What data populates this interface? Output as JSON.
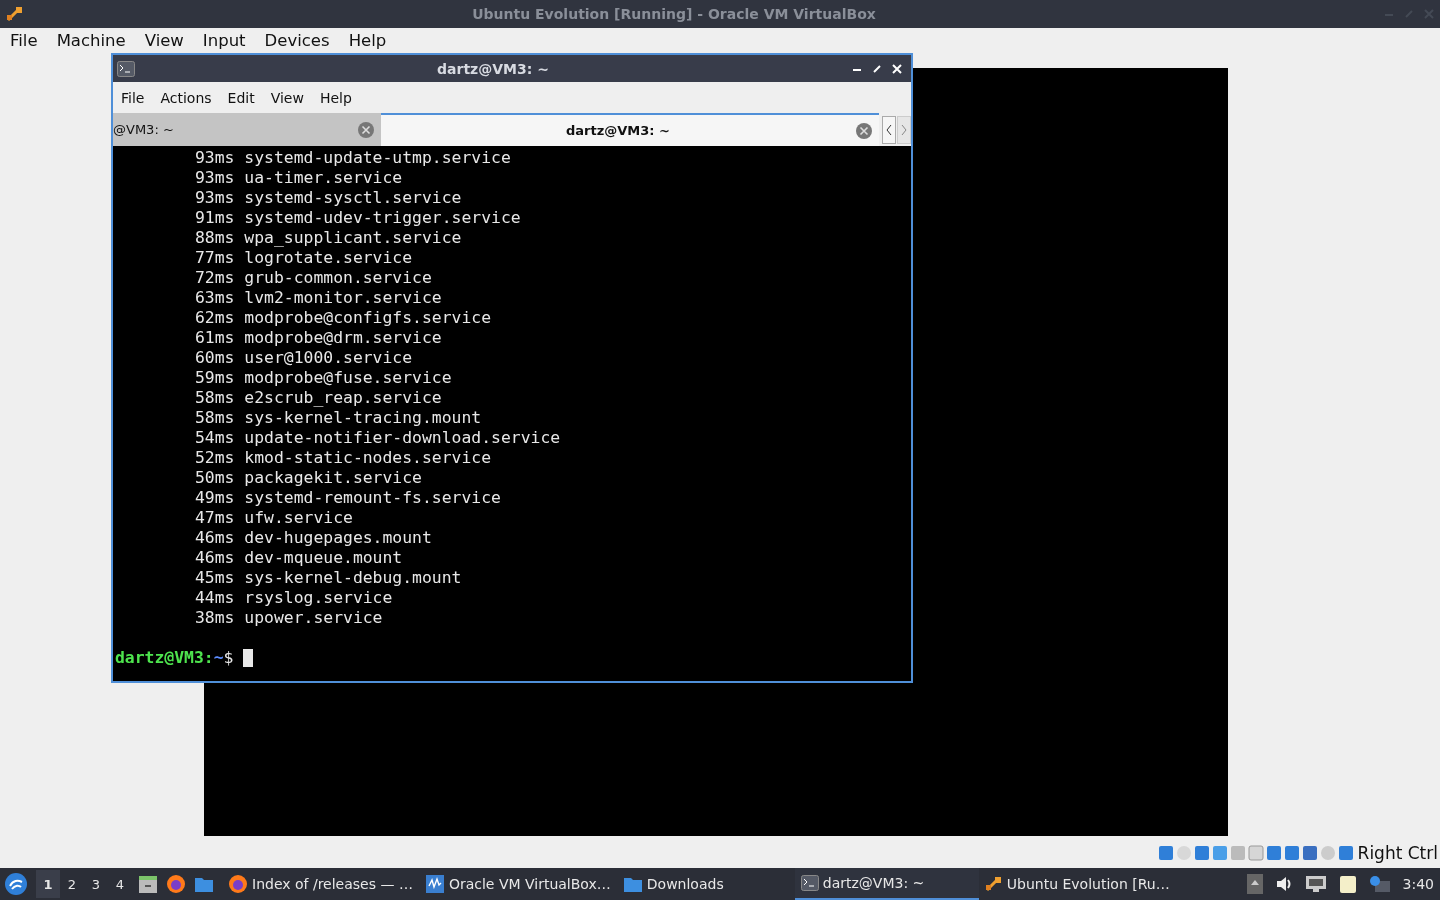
{
  "host_window": {
    "title": "Ubuntu Evolution [Running] - Oracle VM VirtualBox"
  },
  "menu": [
    "File",
    "Machine",
    "View",
    "Input",
    "Devices",
    "Help"
  ],
  "terminal": {
    "title": "dartz@VM3: ~",
    "menu": [
      "File",
      "Actions",
      "Edit",
      "View",
      "Help"
    ],
    "tabs": [
      {
        "label": "@VM3: ~",
        "selected": false
      },
      {
        "label": "dartz@VM3: ~",
        "selected": true
      }
    ],
    "lines": [
      "93ms systemd-update-utmp.service",
      "93ms ua-timer.service",
      "93ms systemd-sysctl.service",
      "91ms systemd-udev-trigger.service",
      "88ms wpa_supplicant.service",
      "77ms logrotate.service",
      "72ms grub-common.service",
      "63ms lvm2-monitor.service",
      "62ms modprobe@configfs.service",
      "61ms modprobe@drm.service",
      "60ms user@1000.service",
      "59ms modprobe@fuse.service",
      "58ms e2scrub_reap.service",
      "58ms sys-kernel-tracing.mount",
      "54ms update-notifier-download.service",
      "52ms kmod-static-nodes.service",
      "50ms packagekit.service",
      "49ms systemd-remount-fs.service",
      "47ms ufw.service",
      "46ms dev-hugepages.mount",
      "46ms dev-mqueue.mount",
      "45ms sys-kernel-debug.mount",
      "44ms rsyslog.service",
      "38ms upower.service"
    ],
    "prompt": {
      "user_host": "dartz@VM3:",
      "path": "~",
      "symbol": "$"
    }
  },
  "host_key": "Right Ctrl",
  "taskbar": {
    "workspaces": [
      {
        "label": "1",
        "selected": true
      },
      {
        "label": "2",
        "selected": false
      },
      {
        "label": "3",
        "selected": false
      },
      {
        "label": "4",
        "selected": false
      }
    ],
    "tasks": [
      {
        "kind": "browser",
        "label": "Index of /releases — …",
        "selected": false
      },
      {
        "kind": "virtualbox",
        "label": "Oracle VM VirtualBox…",
        "selected": false
      },
      {
        "kind": "folder",
        "label": "Downloads",
        "selected": false
      },
      {
        "kind": "terminal",
        "label": "dartz@VM3: ~",
        "selected": true
      },
      {
        "kind": "vm",
        "label": "Ubuntu Evolution [Ru…",
        "selected": false
      }
    ],
    "clock": "3:40"
  }
}
